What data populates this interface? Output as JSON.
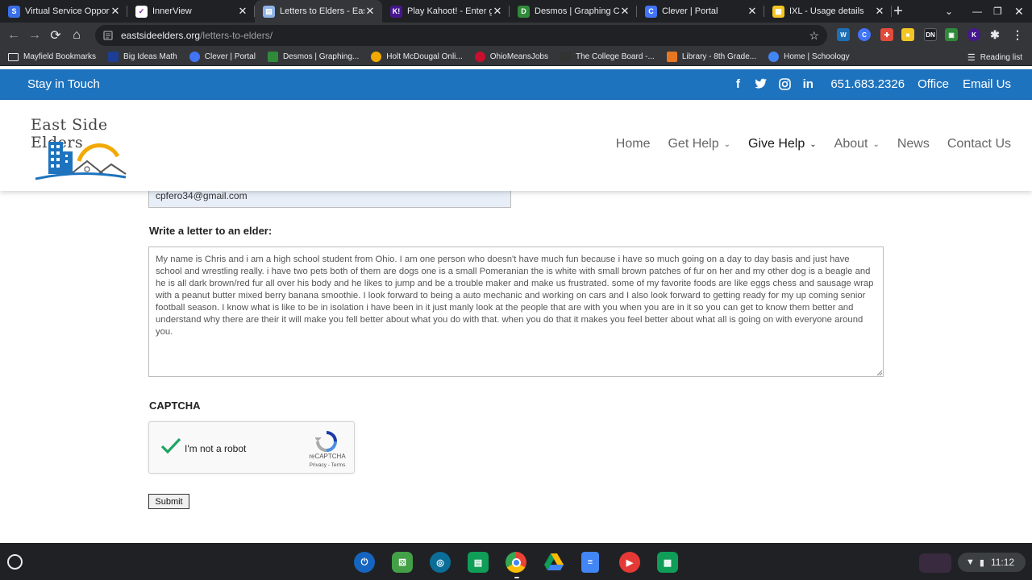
{
  "browser": {
    "tabs": [
      {
        "title": "Virtual Service Opport",
        "favicon_color": "#3a6ee8",
        "favicon_glyph": "S",
        "active": false
      },
      {
        "title": "InnerView",
        "favicon_color": "#ffffff",
        "favicon_glyph": "✓",
        "active": false
      },
      {
        "title": "Letters to Elders - East",
        "favicon_color": "#8fb4e6",
        "favicon_glyph": "▤",
        "active": true
      },
      {
        "title": "Play Kahoot! - Enter g",
        "favicon_color": "#46178f",
        "favicon_glyph": "K!",
        "active": false
      },
      {
        "title": "Desmos | Graphing Ca",
        "favicon_color": "#2f8a3a",
        "favicon_glyph": "D",
        "active": false
      },
      {
        "title": "Clever | Portal",
        "favicon_color": "#4274f6",
        "favicon_glyph": "C",
        "active": false
      },
      {
        "title": "IXL - Usage details",
        "favicon_color": "#f3c623",
        "favicon_glyph": "▦",
        "active": false
      }
    ],
    "url_host": "eastsideelders.org",
    "url_path": "/letters-to-elders/",
    "bookmarks": [
      {
        "label": "Mayfield Bookmarks",
        "icon": "folder-icon",
        "color": "#e8eaed"
      },
      {
        "label": "Big Ideas Math",
        "icon": "bigideas-icon",
        "color": "#1c3f95"
      },
      {
        "label": "Clever | Portal",
        "icon": "clever-icon",
        "color": "#4274f6"
      },
      {
        "label": "Desmos | Graphing...",
        "icon": "desmos-icon",
        "color": "#2f8a3a"
      },
      {
        "label": "Holt McDougal Onli...",
        "icon": "holt-icon",
        "color": "#f2a900"
      },
      {
        "label": "OhioMeansJobs",
        "icon": "ohio-icon",
        "color": "#c8102e"
      },
      {
        "label": "The College Board -...",
        "icon": "collegeboard-icon",
        "color": "#333333"
      },
      {
        "label": "Library - 8th Grade...",
        "icon": "library-icon",
        "color": "#e87722"
      },
      {
        "label": "Home | Schoology",
        "icon": "google-icon",
        "color": "#4285f4"
      }
    ],
    "reading_list": "Reading list"
  },
  "site": {
    "topbar": {
      "stay_in_touch": "Stay in Touch",
      "phone": "651.683.2326",
      "office": "Office",
      "email": "Email Us",
      "accent": "#1e73be"
    },
    "logo_text": "East Side Elders",
    "nav": {
      "home": "Home",
      "get_help": "Get Help",
      "give_help": "Give Help",
      "about": "About",
      "news": "News",
      "contact": "Contact Us"
    }
  },
  "form": {
    "email_value": "cpfero34@gmail.com",
    "letter_label": "Write a letter to an elder:",
    "letter_value": "My name is Chris and i am a high school student from Ohio. I am one person who doesn't have much fun because i have so much going on a day to day basis and just have school and wrestling really. i have two pets both of them are dogs one is a small Pomeranian the is white with small brown patches of fur on her and my other dog is a beagle and he is all dark brown/red fur all over his body and he likes to jump and be a trouble maker and make us frustrated. some of my favorite foods are like eggs chess and sausage wrap with a peanut butter mixed berry banana smoothie. I look forward to being a auto mechanic and working on cars  and I also look forward to getting ready for my up coming senior football season. I know what is like to be in isolation i have been in it just manly look at the people that are with you when you are in it so you can get to know them better and understand why there are their it will make you fell better about what you do with that. when you do that it makes you feel better about what all is going on with everyone around you.",
    "captcha_label": "CAPTCHA",
    "captcha_text": "I'm not a robot",
    "recaptcha": "reCAPTCHA",
    "recaptcha_links": "Privacy - Terms",
    "submit": "Submit"
  },
  "shelf": {
    "time": "11:12"
  }
}
